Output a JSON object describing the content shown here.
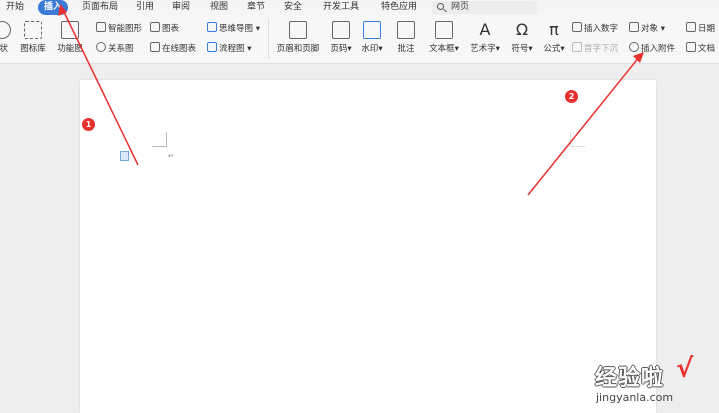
{
  "tabs": [
    "开始",
    "插入",
    "页面布局",
    "引用",
    "审阅",
    "视图",
    "章节",
    "安全",
    "开发工具",
    "特色应用"
  ],
  "search": {
    "label": "网页"
  },
  "ribbon": {
    "shape_partial": "状",
    "icon_library": "图标库",
    "function_partial": "功能图",
    "smart_art": "智能图形",
    "chart": "图表",
    "relation_chart": "关系图",
    "online_chart": "在线图表",
    "mind_map": "思维导图",
    "flow_chart": "流程图",
    "header_footer": "页眉和页脚",
    "page_number": "页码",
    "watermark": "水印",
    "comment": "批注",
    "text_box": "文本框",
    "art_text": "艺术字",
    "symbol": "符号",
    "formula": "公式",
    "insert_number": "插入数字",
    "object": "对象",
    "date_partial": "日期",
    "drop_cap": "首字下沉",
    "insert_attachment": "插入附件",
    "doc_partial": "文档"
  },
  "annotations": {
    "badge1": "1",
    "badge2": "2"
  },
  "watermark_site": {
    "text": "经验啦",
    "check": "√",
    "url": "jingyanla.com"
  }
}
